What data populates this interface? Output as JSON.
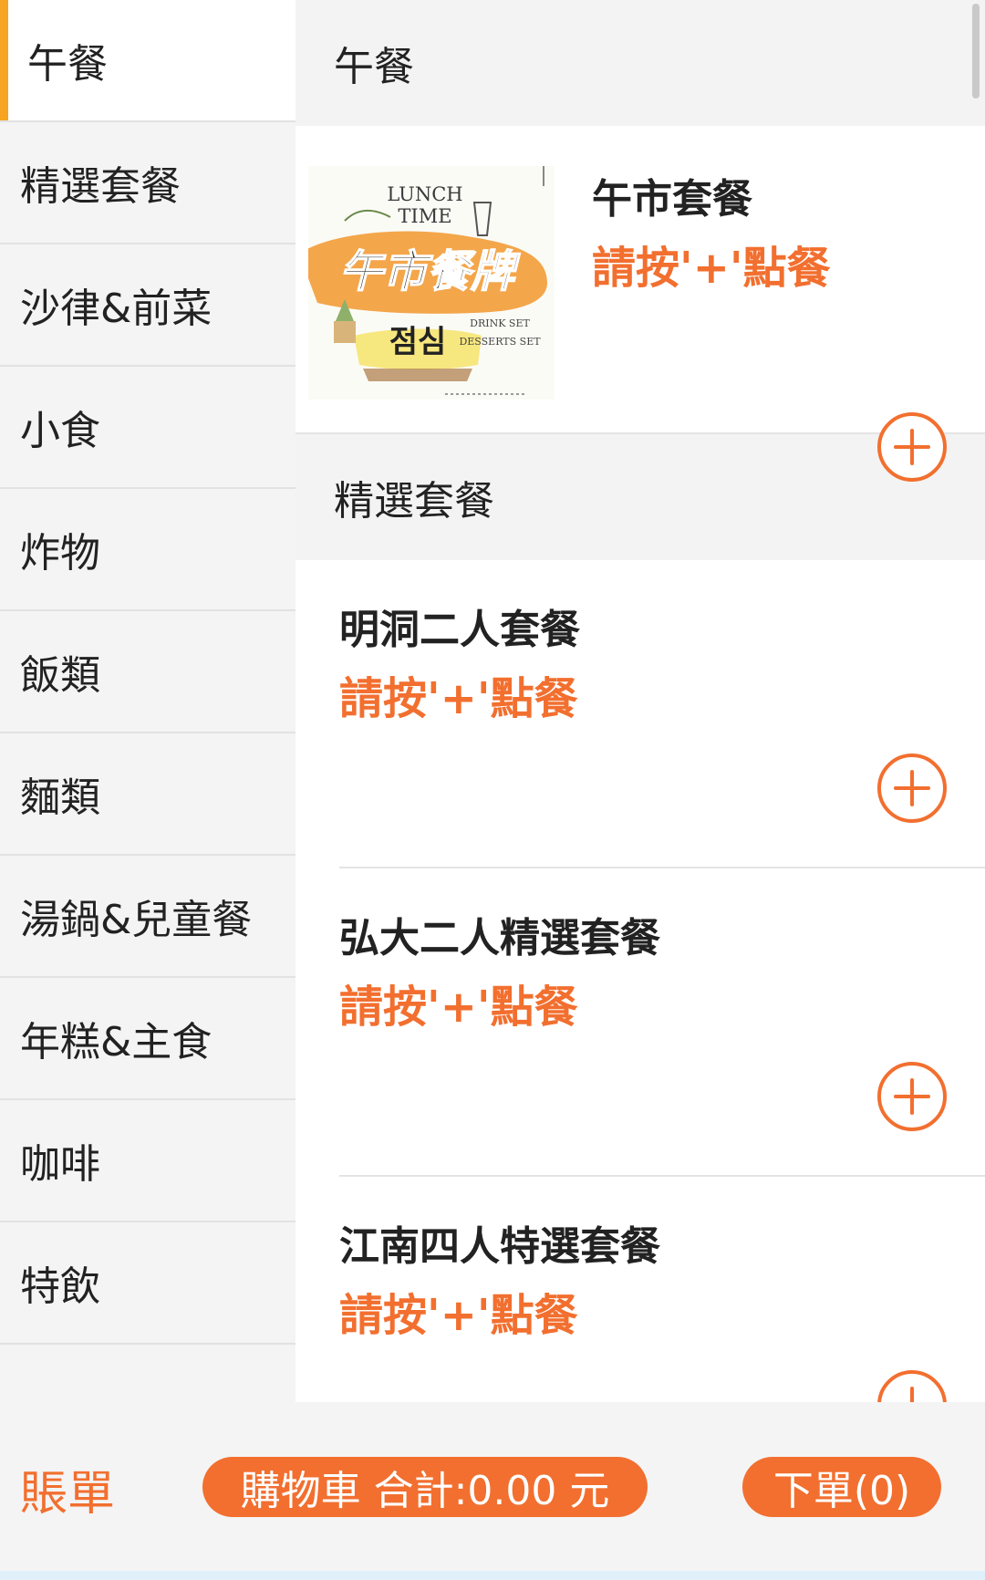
{
  "sidebar": {
    "items": [
      {
        "label": "午餐",
        "active": true
      },
      {
        "label": "精選套餐"
      },
      {
        "label": "沙律&前菜"
      },
      {
        "label": "小食"
      },
      {
        "label": "炸物"
      },
      {
        "label": "飯類"
      },
      {
        "label": "麵類"
      },
      {
        "label": "湯鍋&兒童餐"
      },
      {
        "label": "年糕&主食"
      },
      {
        "label": "咖啡"
      },
      {
        "label": "特飲"
      }
    ]
  },
  "sections": [
    {
      "title": "午餐",
      "items": [
        {
          "name": "午市套餐",
          "hint": "請按'+'點餐",
          "image": {
            "line1": "LUNCH",
            "line2": "TIME",
            "banner": "午市餐牌",
            "korean": "점심",
            "set1": "DRINK SET",
            "set2": "DESSERTS SET"
          }
        }
      ]
    },
    {
      "title": "精選套餐",
      "items": [
        {
          "name": "明洞二人套餐",
          "hint": "請按'+'點餐"
        },
        {
          "name": "弘大二人精選套餐",
          "hint": "請按'+'點餐"
        },
        {
          "name": "江南四人特選套餐",
          "hint": "請按'+'點餐"
        }
      ]
    }
  ],
  "bottom_bar": {
    "bill_label": "賬單",
    "cart_label": "購物車 合計:0.00 元",
    "order_label": "下單(0)"
  },
  "colors": {
    "accent": "#f26f2f",
    "active_indicator": "#f6a421"
  },
  "icons": {
    "add": "plus-circle-icon"
  }
}
